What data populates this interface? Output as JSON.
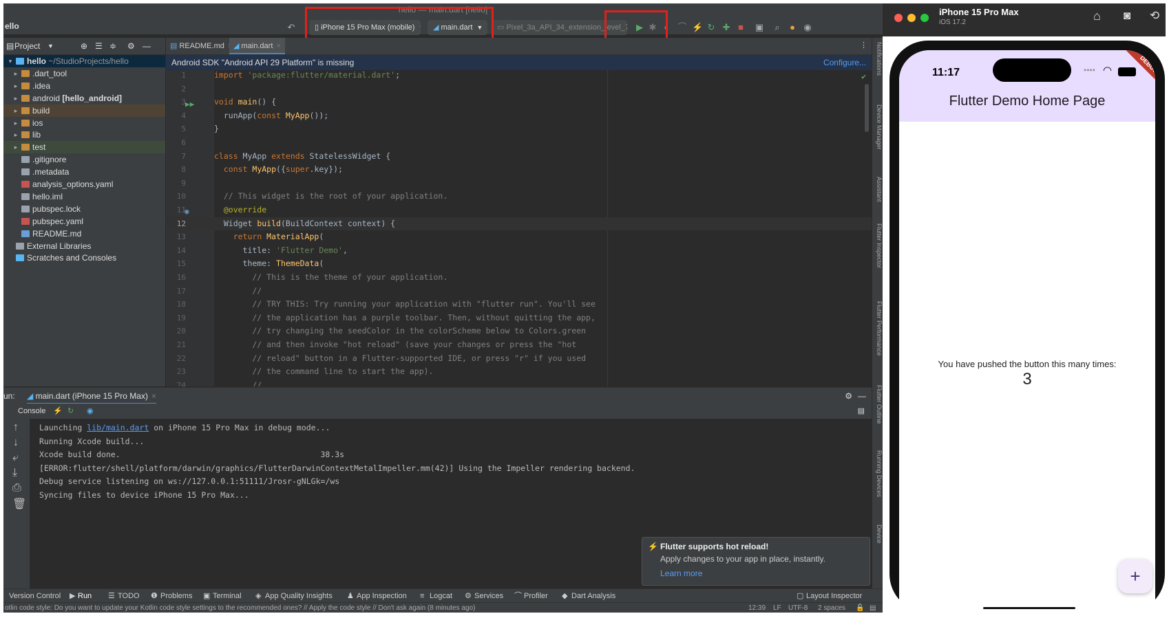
{
  "ide": {
    "window_title": "hello — main.dart [hello]",
    "project_name": "ello",
    "device_selector": "iPhone 15 Pro Max (mobile)",
    "run_config": "main.dart",
    "emulator": "Pixel_3a_API_34_extension_level_7_ar...",
    "project_panel_title": "Project",
    "tree": [
      {
        "label": "hello",
        "extra": "~/StudioProjects/hello",
        "indent": 0,
        "arrow": "▾",
        "icon": "flutter-icon",
        "bold": true
      },
      {
        "label": ".dart_tool",
        "indent": 1,
        "arrow": "▸",
        "icon": "folder-icon"
      },
      {
        "label": ".idea",
        "indent": 1,
        "arrow": "▸",
        "icon": "folder-icon"
      },
      {
        "label": "android",
        "extra": "[hello_android]",
        "indent": 1,
        "arrow": "▸",
        "icon": "folder-icon"
      },
      {
        "label": "build",
        "indent": 1,
        "arrow": "▸",
        "icon": "folder-icon"
      },
      {
        "label": "ios",
        "indent": 1,
        "arrow": "▸",
        "icon": "folder-icon"
      },
      {
        "label": "lib",
        "indent": 1,
        "arrow": "▸",
        "icon": "folder-icon"
      },
      {
        "label": "test",
        "indent": 1,
        "arrow": "▸",
        "icon": "folder-icon"
      },
      {
        "label": ".gitignore",
        "indent": 1,
        "arrow": "",
        "icon": "file-icon"
      },
      {
        "label": ".metadata",
        "indent": 1,
        "arrow": "",
        "icon": "file-icon"
      },
      {
        "label": "analysis_options.yaml",
        "indent": 1,
        "arrow": "",
        "icon": "yaml-file-icon"
      },
      {
        "label": "hello.iml",
        "indent": 1,
        "arrow": "",
        "icon": "iml-file-icon"
      },
      {
        "label": "pubspec.lock",
        "indent": 1,
        "arrow": "",
        "icon": "file-icon"
      },
      {
        "label": "pubspec.yaml",
        "indent": 1,
        "arrow": "",
        "icon": "yaml-file-icon"
      },
      {
        "label": "README.md",
        "indent": 1,
        "arrow": "",
        "icon": "md-file-icon"
      },
      {
        "label": "External Libraries",
        "indent": 0,
        "arrow": "",
        "icon": "library-icon"
      },
      {
        "label": "Scratches and Consoles",
        "indent": 0,
        "arrow": "",
        "icon": "scratch-icon"
      }
    ],
    "tabs": [
      {
        "label": "README.md",
        "active": false
      },
      {
        "label": "main.dart",
        "active": true
      }
    ],
    "banner_text": "Android SDK \"Android API 29 Platform\" is missing",
    "banner_action": "Configure...",
    "code": [
      {
        "n": "1",
        "t": [
          [
            "kw",
            "import "
          ],
          [
            "str",
            "'package:flutter/material.dart'"
          ],
          [
            "txt",
            ";"
          ]
        ]
      },
      {
        "n": "2",
        "t": []
      },
      {
        "n": "3",
        "t": [
          [
            "kw",
            "void "
          ],
          [
            "cls",
            "main"
          ],
          [
            "txt",
            "() {"
          ]
        ]
      },
      {
        "n": "4",
        "t": [
          [
            "txt",
            "  runApp("
          ],
          [
            "kw",
            "const "
          ],
          [
            "cls",
            "MyApp"
          ],
          [
            "txt",
            "());"
          ]
        ]
      },
      {
        "n": "5",
        "t": [
          [
            "txt",
            "}"
          ]
        ]
      },
      {
        "n": "6",
        "t": []
      },
      {
        "n": "7",
        "t": [
          [
            "kw",
            "class "
          ],
          [
            "txt",
            "MyApp "
          ],
          [
            "kw",
            "extends "
          ],
          [
            "txt",
            "StatelessWidget {"
          ]
        ]
      },
      {
        "n": "8",
        "t": [
          [
            "txt",
            "  "
          ],
          [
            "kw",
            "const "
          ],
          [
            "cls",
            "MyApp"
          ],
          [
            "txt",
            "({"
          ],
          [
            "kw",
            "super"
          ],
          [
            "txt",
            ".key});"
          ]
        ]
      },
      {
        "n": "9",
        "t": []
      },
      {
        "n": "10",
        "t": [
          [
            "cm",
            "  // This widget is the root of your application."
          ]
        ]
      },
      {
        "n": "11",
        "t": [
          [
            "ann",
            "  @override"
          ]
        ]
      },
      {
        "n": "12",
        "t": [
          [
            "txt",
            "  Widget "
          ],
          [
            "cls",
            "build"
          ],
          [
            "txt",
            "(BuildContext context) {"
          ]
        ]
      },
      {
        "n": "13",
        "t": [
          [
            "txt",
            "    "
          ],
          [
            "kw",
            "return "
          ],
          [
            "cls",
            "MaterialApp"
          ],
          [
            "txt",
            "("
          ]
        ]
      },
      {
        "n": "14",
        "t": [
          [
            "txt",
            "      title: "
          ],
          [
            "str",
            "'Flutter Demo'"
          ],
          [
            "txt",
            ","
          ]
        ]
      },
      {
        "n": "15",
        "t": [
          [
            "txt",
            "      theme: "
          ],
          [
            "cls",
            "ThemeData"
          ],
          [
            "txt",
            "("
          ]
        ]
      },
      {
        "n": "16",
        "t": [
          [
            "cm",
            "        // This is the theme of your application."
          ]
        ]
      },
      {
        "n": "17",
        "t": [
          [
            "cm",
            "        //"
          ]
        ]
      },
      {
        "n": "18",
        "t": [
          [
            "cm",
            "        // TRY THIS: Try running your application with \"flutter run\". You'll see"
          ]
        ]
      },
      {
        "n": "19",
        "t": [
          [
            "cm",
            "        // the application has a purple toolbar. Then, without quitting the app,"
          ]
        ]
      },
      {
        "n": "20",
        "t": [
          [
            "cm",
            "        // try changing the seedColor in the colorScheme below to Colors.green"
          ]
        ]
      },
      {
        "n": "21",
        "t": [
          [
            "cm",
            "        // and then invoke \"hot reload\" (save your changes or press the \"hot"
          ]
        ]
      },
      {
        "n": "22",
        "t": [
          [
            "cm",
            "        // reload\" button in a Flutter-supported IDE, or press \"r\" if you used"
          ]
        ]
      },
      {
        "n": "23",
        "t": [
          [
            "cm",
            "        // the command line to start the app)."
          ]
        ]
      },
      {
        "n": "24",
        "t": [
          [
            "cm",
            "        //"
          ]
        ]
      }
    ],
    "right_tools": [
      "Notifications",
      "Device Manager",
      "Assistant",
      "Flutter Inspector",
      "Flutter Performance",
      "Flutter Outline",
      "Running Devices",
      "Device"
    ],
    "run_label": "un:",
    "run_tab": "main.dart (iPhone 15 Pro Max)",
    "console_tab": "Console",
    "console_lines": [
      [
        [
          "txt",
          "Launching "
        ],
        [
          "link",
          "lib/main.dart"
        ],
        [
          "txt",
          " on iPhone 15 Pro Max in debug mode..."
        ]
      ],
      [
        [
          "txt",
          "Running Xcode build..."
        ]
      ],
      [
        [
          "txt",
          "Xcode build done.                                          38.3s"
        ]
      ],
      [
        [
          "txt",
          "[ERROR:flutter/shell/platform/darwin/graphics/FlutterDarwinContextMetalImpeller.mm(42)] Using the Impeller rendering backend."
        ]
      ],
      [
        [
          "txt",
          "Debug service listening on ws://127.0.0.1:51111/Jrosr-gNLGk=/ws"
        ]
      ],
      [
        [
          "txt",
          "Syncing files to device iPhone 15 Pro Max..."
        ]
      ]
    ],
    "popup": {
      "title": "Flutter supports hot reload!",
      "body": "Apply changes to your app in place, instantly.",
      "link": "Learn more"
    },
    "tool_windows": [
      "Version Control",
      "Run",
      "TODO",
      "Problems",
      "Terminal",
      "App Quality Insights",
      "App Inspection",
      "Logcat",
      "Services",
      "Profiler",
      "Dart Analysis"
    ],
    "layout_inspector": "Layout Inspector",
    "status_message": "otlin code style: Do you want to update your Kotlin code style settings to the recommended ones? // Apply the code style // Don't ask again (8 minutes ago)",
    "status_position": "12:39",
    "status_lf": "LF",
    "status_encoding": "UTF-8",
    "status_indent": "2 spaces"
  },
  "simulator": {
    "device_name": "iPhone 15 Pro Max",
    "os_version": "iOS 17.2",
    "time": "11:17",
    "debug_banner": "DEBUG",
    "app_title": "Flutter Demo Home Page",
    "message": "You have pushed the button this many times:",
    "counter": "3",
    "fab_label": "+"
  },
  "colors": {
    "highlight_box": "#e0211b",
    "app_bar": "#e9ddff",
    "run_green": "#59a869",
    "stop_red": "#c75450"
  }
}
